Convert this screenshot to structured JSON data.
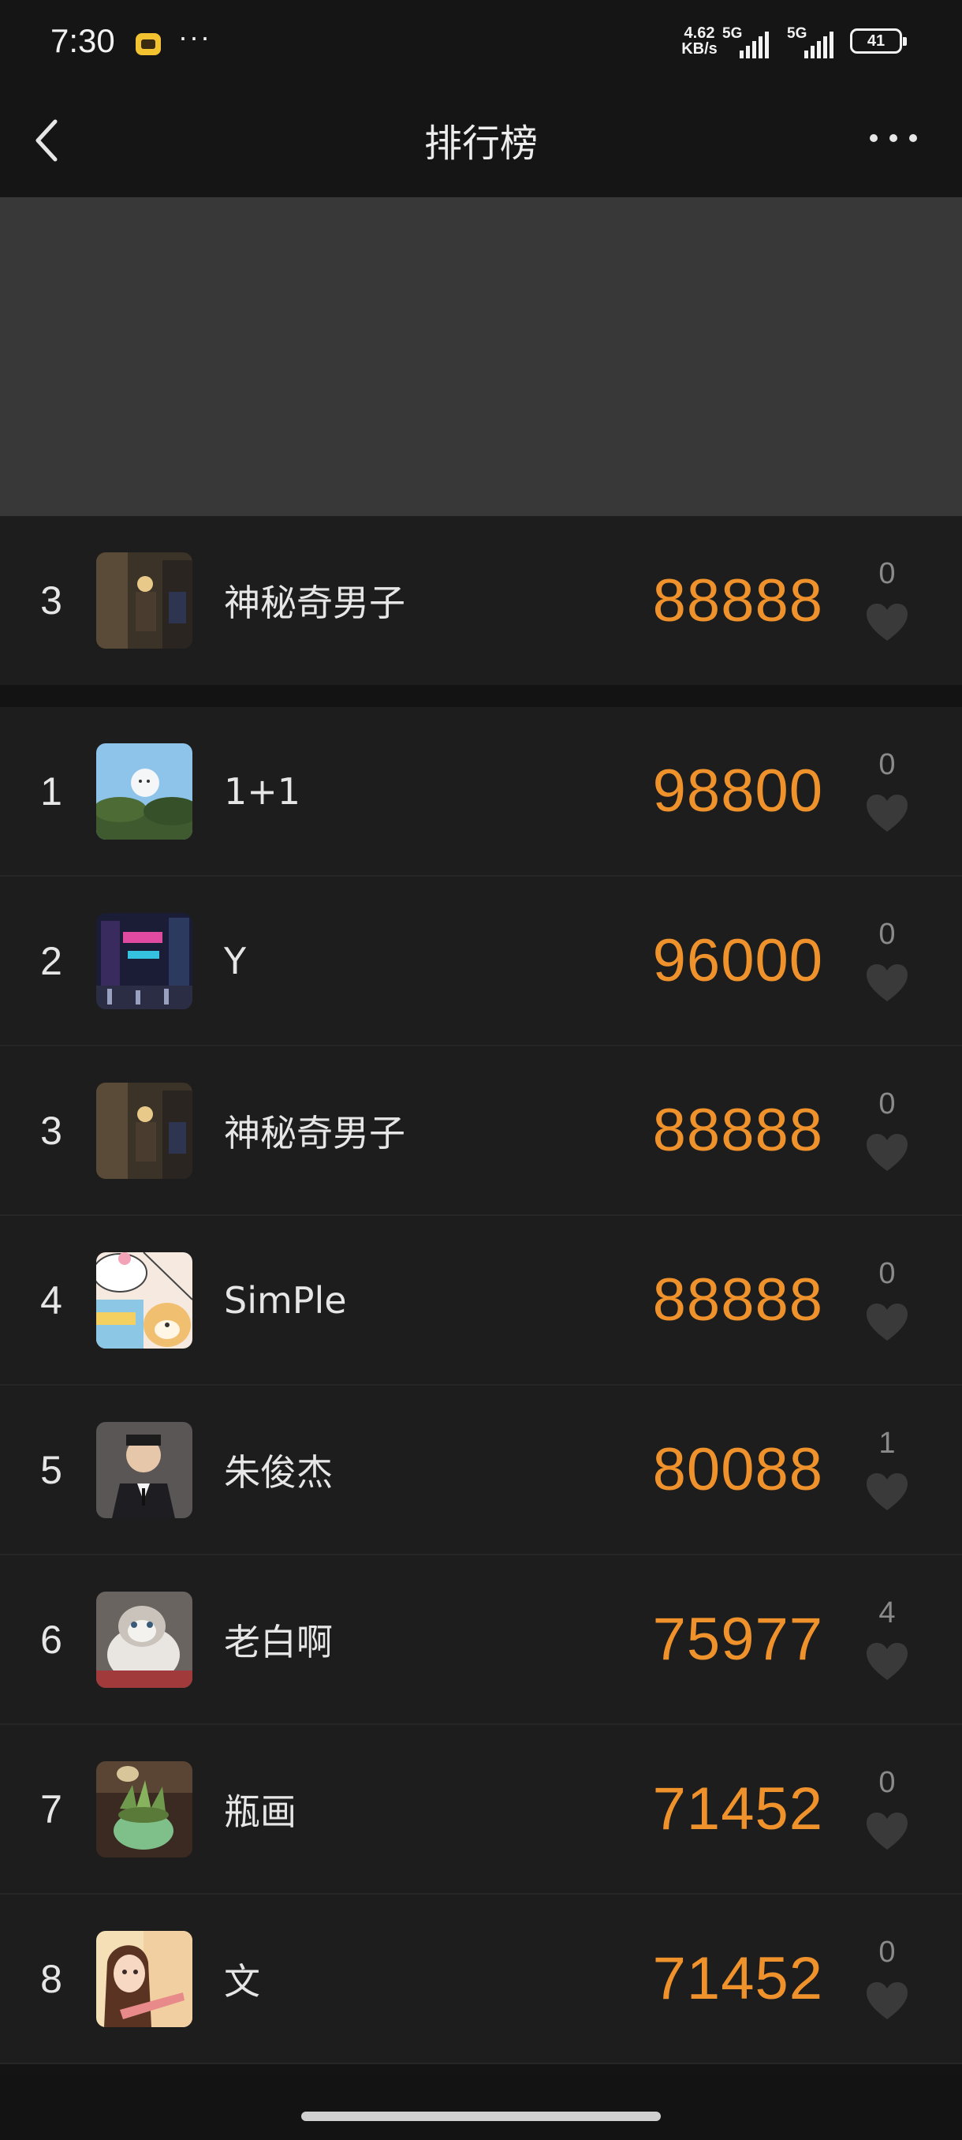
{
  "status_bar": {
    "time": "7:30",
    "more": "···",
    "speed_value": "4.62",
    "speed_unit": "KB/s",
    "sim1_label": "5G",
    "sim2_label": "5G",
    "battery": "41"
  },
  "header": {
    "title": "排行榜",
    "back_icon": "back-arrow-icon",
    "more_icon": "more-dots-icon"
  },
  "my_rank": {
    "rank": "3",
    "name": "神秘奇男子",
    "score": "88888",
    "likes": "0"
  },
  "leaderboard": [
    {
      "rank": "1",
      "name": "1+1",
      "score": "98800",
      "likes": "0"
    },
    {
      "rank": "2",
      "name": "Y",
      "score": "96000",
      "likes": "0"
    },
    {
      "rank": "3",
      "name": "神秘奇男子",
      "score": "88888",
      "likes": "0"
    },
    {
      "rank": "4",
      "name": "SimPle",
      "score": "88888",
      "likes": "0"
    },
    {
      "rank": "5",
      "name": "朱俊杰",
      "score": "80088",
      "likes": "1"
    },
    {
      "rank": "6",
      "name": "老白啊",
      "score": "75977",
      "likes": "4"
    },
    {
      "rank": "7",
      "name": "瓶画",
      "score": "71452",
      "likes": "0"
    },
    {
      "rank": "8",
      "name": "文",
      "score": "71452",
      "likes": "0"
    }
  ],
  "colors": {
    "score": "#f0922c",
    "background": "#1d1d1d",
    "banner": "#383838"
  }
}
